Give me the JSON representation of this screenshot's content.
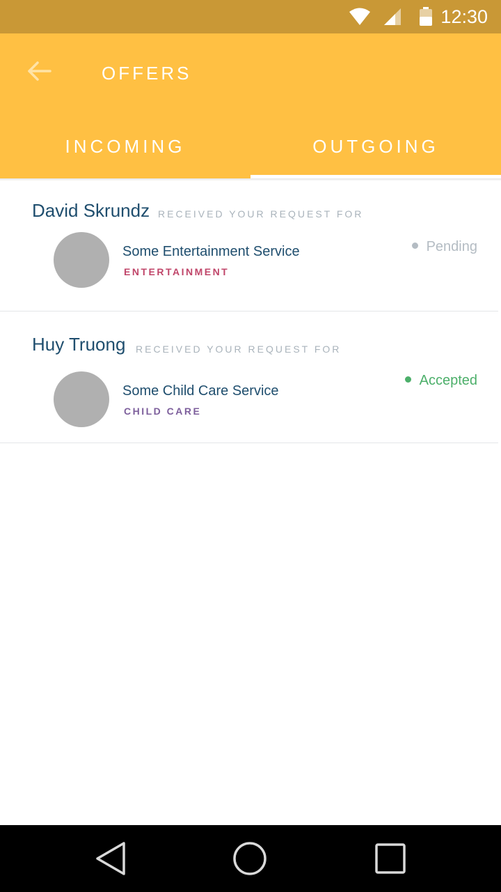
{
  "status_bar": {
    "time": "12:30",
    "icons": [
      "wifi-icon",
      "signal-icon",
      "battery-icon"
    ]
  },
  "app_bar": {
    "title": "OFFERS",
    "back_icon": "arrow-back-icon",
    "tabs": [
      {
        "label": "INCOMING",
        "selected": false
      },
      {
        "label": "OUTGOING",
        "selected": true
      }
    ]
  },
  "offers": [
    {
      "name": "David Skrundz",
      "received_text": "RECEIVED YOUR REQUEST FOR",
      "service": "Some Entertainment Service",
      "category": "ENTERTAINMENT",
      "category_color": "#c0466a",
      "status": "Pending",
      "status_color": "#b4bcc3",
      "dot_color": "#b4bcc3"
    },
    {
      "name": "Huy Truong",
      "received_text": "RECEIVED YOUR REQUEST FOR",
      "service": "Some Child Care Service",
      "category": "CHILD CARE",
      "category_color": "#7d5f9c",
      "status": "Accepted",
      "status_color": "#4caf6a",
      "dot_color": "#4caf6a"
    }
  ],
  "nav_bar": {
    "icons": [
      "back-triangle-icon",
      "home-circle-icon",
      "recents-square-icon"
    ]
  },
  "colors": {
    "status_bar": "#c99836",
    "app_bar": "#ffc043",
    "name_text": "#1f4e6e",
    "avatar": "#b0b0b0"
  }
}
